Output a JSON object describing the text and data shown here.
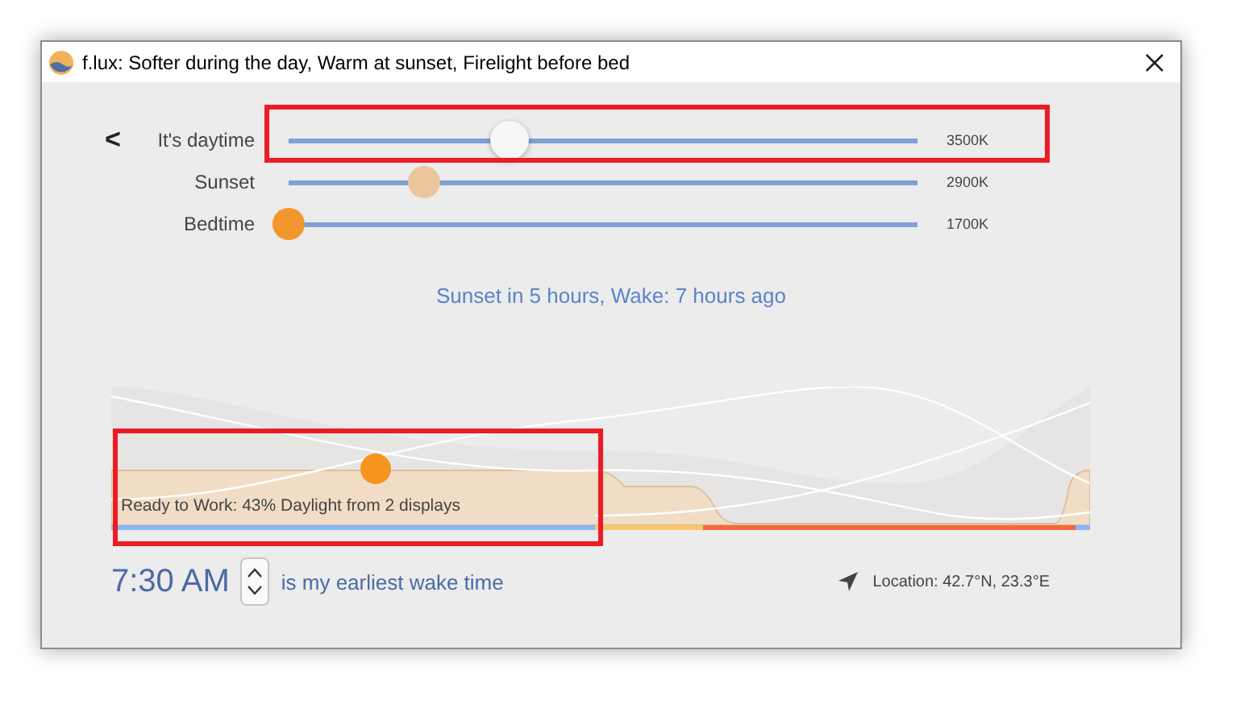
{
  "window": {
    "title": "f.lux: Softer during the day, Warm at sunset, Firelight before bed"
  },
  "back_button": "<",
  "sliders": [
    {
      "label": "It's daytime",
      "level": 0.35,
      "reading": "3500K",
      "color": "#f6f6f6"
    },
    {
      "label": "Sunset",
      "level": 0.215,
      "reading": "2900K",
      "color": "#ebc59d"
    },
    {
      "label": "Bedtime",
      "level": 0.0,
      "reading": "1700K",
      "color": "#f3962d"
    }
  ],
  "status": "Sunset in 5 hours, Wake: 7 hours ago",
  "timeline": {
    "caption": "Ready to Work: 43% Daylight from 2 displays"
  },
  "wake": {
    "time": "7:30 AM",
    "text": "is my earliest wake time"
  },
  "location": "Location: 42.7°N, 23.3°E"
}
